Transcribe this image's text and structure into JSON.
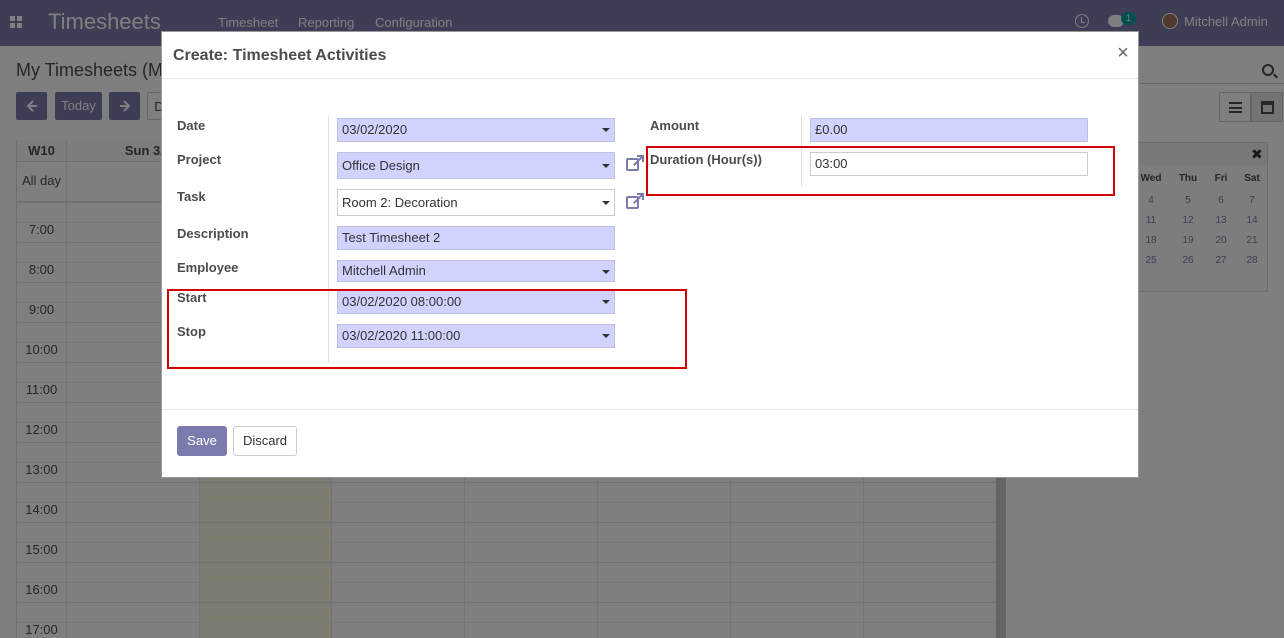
{
  "navbar": {
    "app_title": "Timesheets",
    "menu": [
      "Timesheet",
      "Reporting",
      "Configuration"
    ],
    "message_count": "1",
    "user_name": "Mitchell Admin"
  },
  "control_panel": {
    "breadcrumb": "My Timesheets (M",
    "today_label": "Today",
    "scale_button_partial": "D"
  },
  "calendar": {
    "week_label": "W10",
    "first_day_label": "Sun 3/1",
    "all_day_label": "All day",
    "hours": [
      "7:00",
      "8:00",
      "9:00",
      "10:00",
      "11:00",
      "12:00",
      "13:00",
      "14:00",
      "15:00",
      "16:00",
      "17:00"
    ]
  },
  "mini_calendar": {
    "weekdays": [
      "Wed",
      "Thu",
      "Fri",
      "Sat"
    ],
    "rows": [
      [
        "4",
        "5",
        "6",
        "7"
      ],
      [
        "11",
        "12",
        "13",
        "14"
      ],
      [
        "18",
        "19",
        "20",
        "21"
      ],
      [
        "25",
        "26",
        "27",
        "28"
      ]
    ]
  },
  "dialog": {
    "title": "Create: Timesheet Activities",
    "close_glyph": "×",
    "fields": {
      "date": {
        "label": "Date",
        "value": "03/02/2020"
      },
      "project": {
        "label": "Project",
        "value": "Office Design"
      },
      "task": {
        "label": "Task",
        "value": "Room 2: Decoration"
      },
      "description": {
        "label": "Description",
        "value": "Test Timesheet 2"
      },
      "employee": {
        "label": "Employee",
        "value": "Mitchell Admin"
      },
      "start": {
        "label": "Start",
        "value": "03/02/2020 08:00:00"
      },
      "stop": {
        "label": "Stop",
        "value": "03/02/2020 11:00:00"
      },
      "amount": {
        "label": "Amount",
        "value": "£0.00"
      },
      "duration": {
        "label": "Duration (Hour(s))",
        "value": "03:00"
      }
    },
    "buttons": {
      "save": "Save",
      "discard": "Discard"
    }
  },
  "colors": {
    "brand": "#7c7bad",
    "required_field_bg": "#d2d2ff",
    "highlight_border": "#d20000",
    "badge": "#00a09d"
  }
}
